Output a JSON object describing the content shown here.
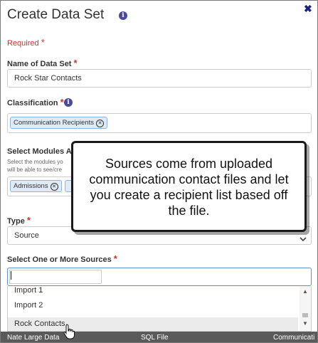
{
  "dialog": {
    "title": "Create Data Set",
    "close_glyph": "✖",
    "required_note": "Required",
    "required_star": "*"
  },
  "form": {
    "name": {
      "label": "Name of Data Set",
      "value": "Rock Star Contacts"
    },
    "classification": {
      "label": "Classification",
      "chip": "Communication Recipients"
    },
    "modules": {
      "label": "Select Modules Al",
      "help_line_1": "Select the modules yo",
      "help_line_2": "will be able to see/cre",
      "chip": "Admissions"
    },
    "type": {
      "label": "Type",
      "value": "Source"
    },
    "sources": {
      "label": "Select One or More Sources",
      "search_value": "",
      "options": [
        "Import 1",
        "Import 2",
        "Rock Contacts"
      ],
      "highlighted": "Rock Contacts"
    }
  },
  "callout": {
    "text": "Sources come from uploaded communication contact files and let you create a recipient list based off the file."
  },
  "background_row": {
    "cells": [
      "Nate Large Data",
      "SQL File",
      "Communicati"
    ]
  },
  "icons": {
    "info": "info-icon",
    "close": "close-icon",
    "chip_remove": "remove-chip-icon",
    "chevron": "chevron-down-icon",
    "cursor": "hand-pointer-icon"
  },
  "colors": {
    "required": "#c0392b",
    "chip_bg": "#dfeaf7",
    "chip_border": "#8fb4e0",
    "focus_border": "#5b8fd6",
    "info_icon": "#4a4a9a"
  }
}
